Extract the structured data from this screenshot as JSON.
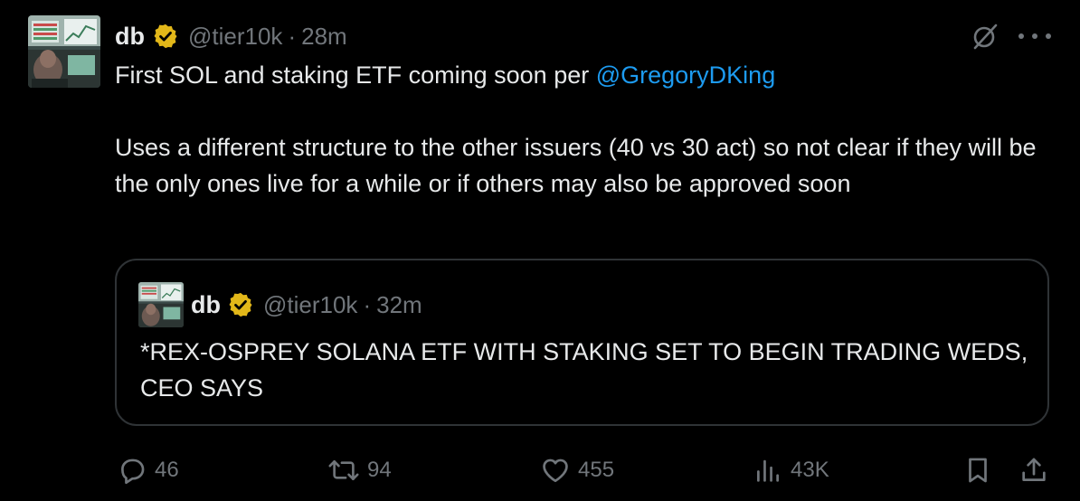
{
  "tweet": {
    "author_name": "db",
    "author_handle": "@tier10k",
    "separator": "·",
    "time": "28m",
    "body_line1_prefix": "First SOL and staking ETF coming soon per ",
    "body_mention": "@GregoryDKing",
    "body_paragraph2": "Uses a different structure to the other issuers (40 vs 30 act) so not clear if they will be the only ones live for a while or if others may also be approved soon"
  },
  "quote": {
    "author_name": "db",
    "author_handle": "@tier10k",
    "separator": "·",
    "time": "32m",
    "text": "*REX-OSPREY SOLANA ETF WITH STAKING SET TO BEGIN TRADING WEDS, CEO SAYS"
  },
  "actions": {
    "replies": "46",
    "reposts": "94",
    "likes": "455",
    "views": "43K"
  },
  "icons": {
    "verified": "verified-badge-icon",
    "grok": "grok-icon",
    "more": "more-icon",
    "reply": "reply-icon",
    "repost": "repost-icon",
    "like": "like-icon",
    "views": "views-icon",
    "bookmark": "bookmark-icon",
    "share": "share-icon"
  },
  "colors": {
    "background": "#000000",
    "text": "#e7e9ea",
    "muted": "#71767b",
    "link": "#1d9bf0",
    "verified_gold": "#e2b719",
    "border": "#2f3336"
  }
}
